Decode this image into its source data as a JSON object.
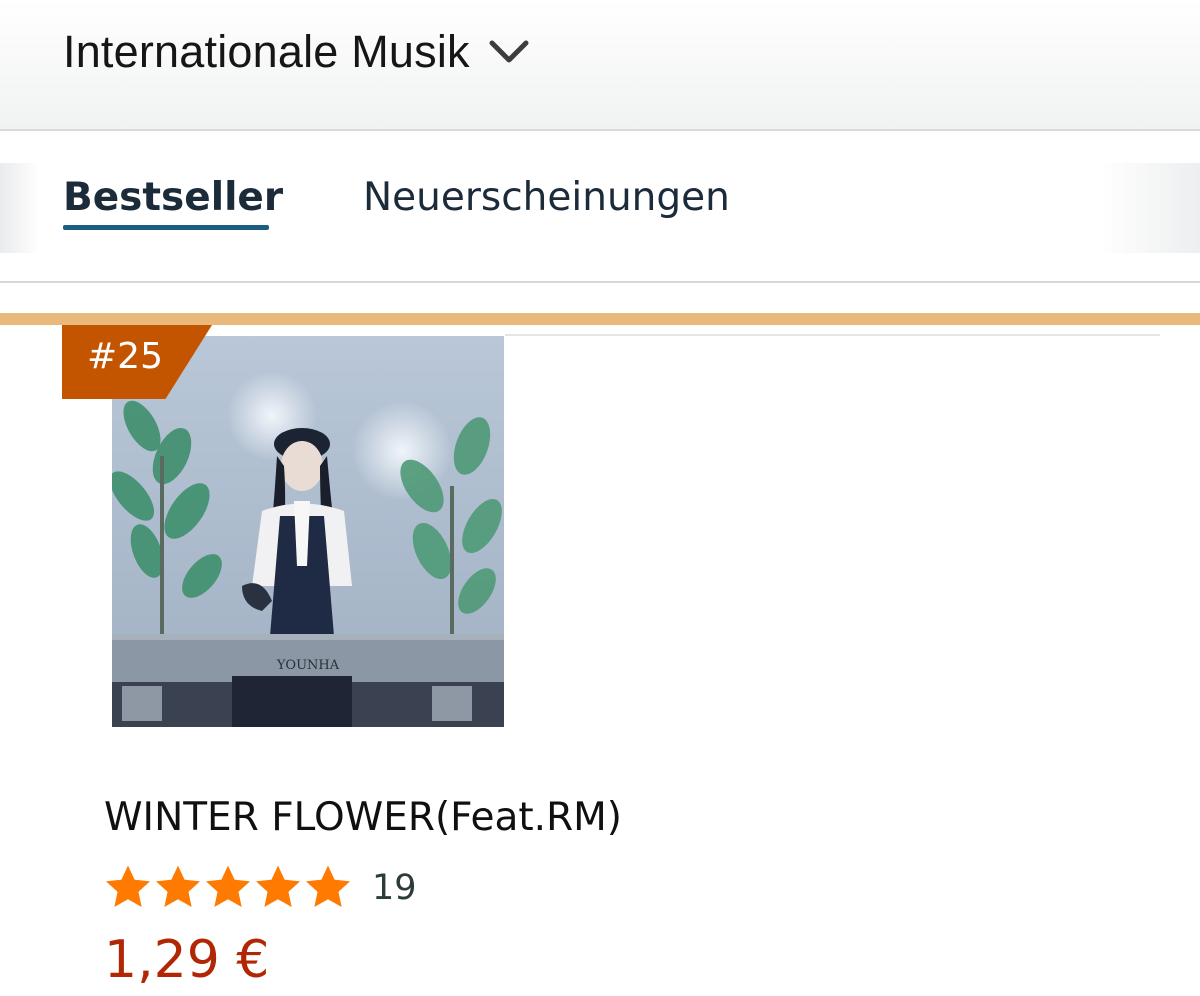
{
  "header": {
    "category_title": "Internationale Musik"
  },
  "tabs": [
    {
      "label": "Bestseller",
      "selected": true
    },
    {
      "label": "Neuerscheinungen",
      "selected": false
    }
  ],
  "product": {
    "rank": "#25",
    "cover_art_text": "YOUNHA",
    "title": "WINTER FLOWER(Feat.RM)",
    "rating_stars": 5,
    "review_count": "19",
    "price": "1,29 €"
  },
  "colors": {
    "accent_underline": "#1b5e81",
    "rank_badge": "#c45500",
    "separator": "#e9b97b",
    "star": "#ff7a00",
    "price": "#b12704"
  },
  "icons": {
    "category_dropdown": "chevron-down-icon",
    "rating": "star-icon"
  }
}
